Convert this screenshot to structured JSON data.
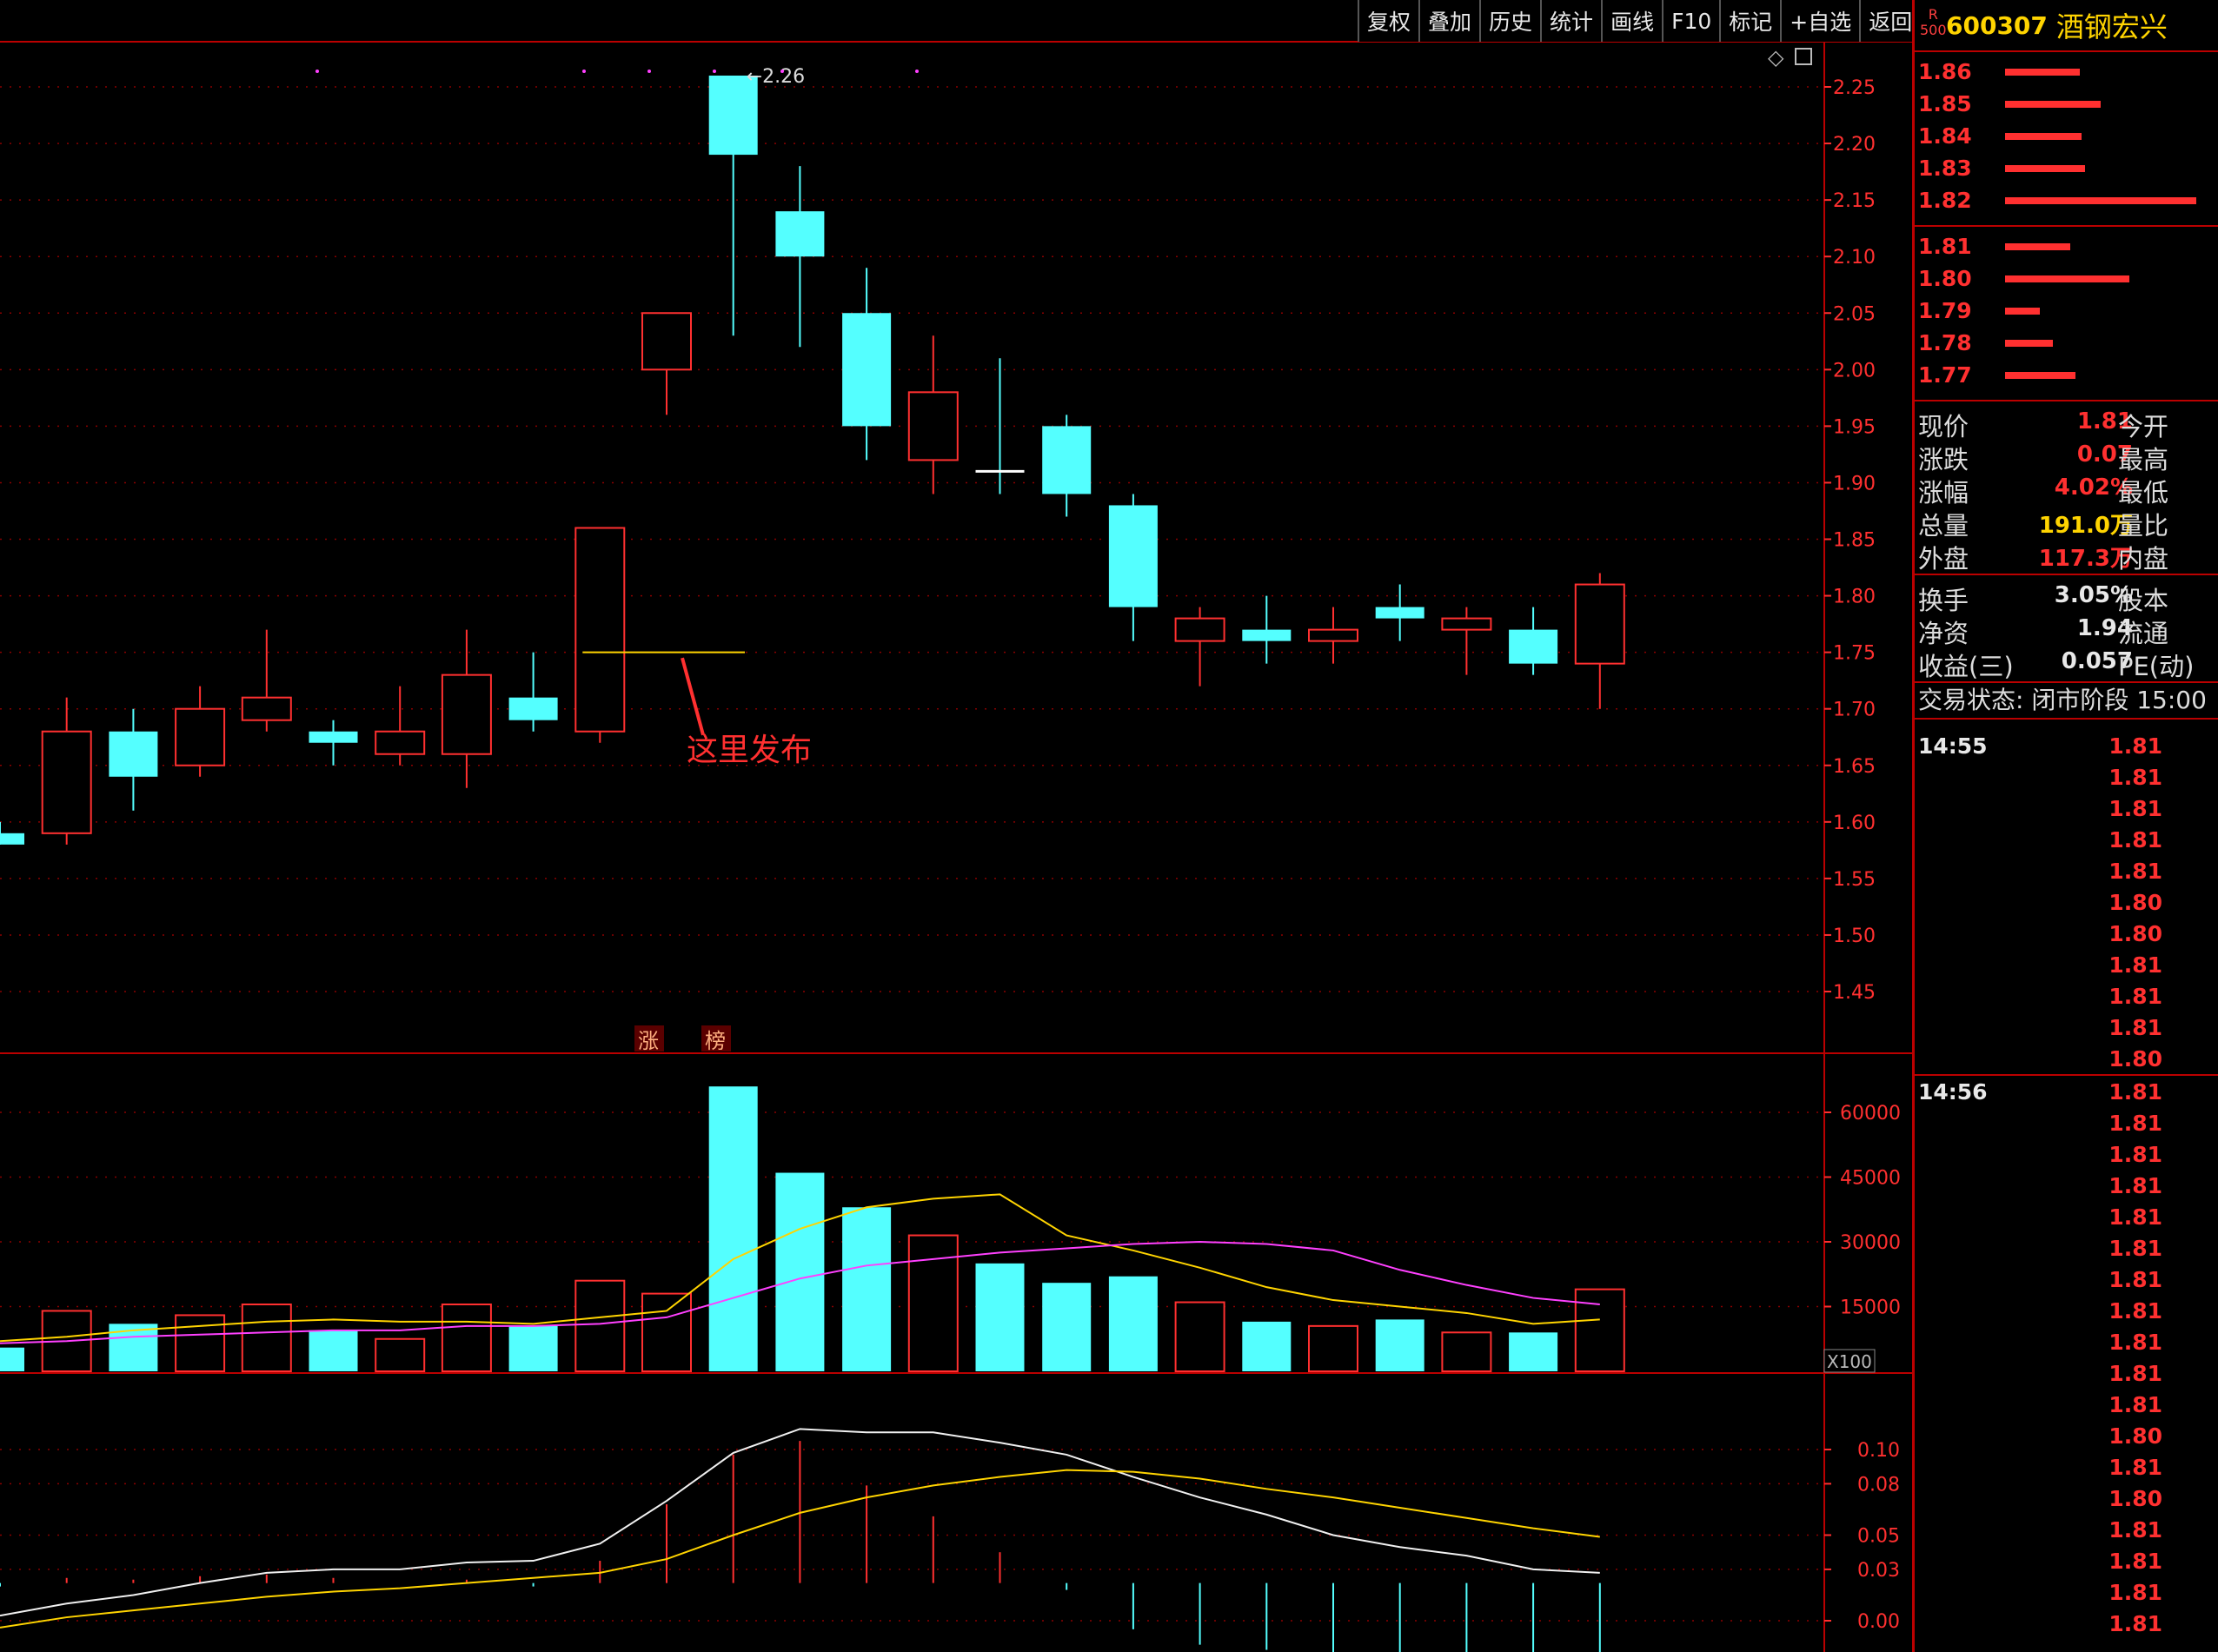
{
  "toolbar": {
    "buttons": [
      "复权",
      "叠加",
      "历史",
      "统计",
      "画线",
      "F10",
      "标记",
      "+自选",
      "返回"
    ]
  },
  "stock": {
    "code": "600307",
    "name": "酒钢宏兴",
    "badge_top": "R",
    "badge_bottom": "500"
  },
  "order_book": {
    "asks": [
      {
        "price": "1.86",
        "size": 0.39
      },
      {
        "price": "1.85",
        "size": 0.5
      },
      {
        "price": "1.84",
        "size": 0.4
      },
      {
        "price": "1.83",
        "size": 0.42
      },
      {
        "price": "1.82",
        "size": 1.0
      }
    ],
    "bids": [
      {
        "price": "1.81",
        "size": 0.34
      },
      {
        "price": "1.80",
        "size": 0.65
      },
      {
        "price": "1.79",
        "size": 0.18
      },
      {
        "price": "1.78",
        "size": 0.25
      },
      {
        "price": "1.77",
        "size": 0.37
      }
    ]
  },
  "stats": {
    "group1": [
      {
        "label": "现价",
        "value": "1.81",
        "color": "#ff3030",
        "label2": "今开"
      },
      {
        "label": "涨跌",
        "value": "0.07",
        "color": "#ff3030",
        "label2": "最高"
      },
      {
        "label": "涨幅",
        "value": "4.02%",
        "color": "#ff3030",
        "label2": "最低"
      },
      {
        "label": "总量",
        "value": "191.0万",
        "color": "#ffd400",
        "label2": "量比"
      },
      {
        "label": "外盘",
        "value": "117.3万",
        "color": "#ff3030",
        "label2": "内盘"
      }
    ],
    "group2": [
      {
        "label": "换手",
        "value": "3.05%",
        "color": "#e8e8e8",
        "label2": "股本"
      },
      {
        "label": "净资",
        "value": "1.94",
        "color": "#e8e8e8",
        "label2": "流通"
      },
      {
        "label": "收益(三)",
        "value": "0.057",
        "color": "#e8e8e8",
        "label2": "PE(动)"
      }
    ]
  },
  "trade_state": "交易状态: 闭市阶段 15:00",
  "ticks": [
    {
      "time": "14:55",
      "price": "1.81"
    },
    {
      "time": "",
      "price": "1.81"
    },
    {
      "time": "",
      "price": "1.81"
    },
    {
      "time": "",
      "price": "1.81"
    },
    {
      "time": "",
      "price": "1.81"
    },
    {
      "time": "",
      "price": "1.80"
    },
    {
      "time": "",
      "price": "1.80"
    },
    {
      "time": "",
      "price": "1.81"
    },
    {
      "time": "",
      "price": "1.81"
    },
    {
      "time": "",
      "price": "1.81"
    },
    {
      "time": "",
      "price": "1.80"
    },
    {
      "time": "14:56",
      "price": "1.81"
    },
    {
      "time": "",
      "price": "1.81"
    },
    {
      "time": "",
      "price": "1.81"
    },
    {
      "time": "",
      "price": "1.81"
    },
    {
      "time": "",
      "price": "1.81"
    },
    {
      "time": "",
      "price": "1.81"
    },
    {
      "time": "",
      "price": "1.81"
    },
    {
      "time": "",
      "price": "1.81"
    },
    {
      "time": "",
      "price": "1.81"
    },
    {
      "time": "",
      "price": "1.81"
    },
    {
      "time": "",
      "price": "1.81"
    },
    {
      "time": "",
      "price": "1.80"
    },
    {
      "time": "",
      "price": "1.81"
    },
    {
      "time": "",
      "price": "1.80"
    },
    {
      "time": "",
      "price": "1.81"
    },
    {
      "time": "",
      "price": "1.81"
    },
    {
      "time": "",
      "price": "1.81"
    },
    {
      "time": "",
      "price": "1.81"
    }
  ],
  "chart_data": [
    {
      "type": "candlestick",
      "ylim": [
        1.42,
        2.28
      ],
      "yticks": [
        "2.25",
        "2.20",
        "2.15",
        "2.10",
        "2.05",
        "2.00",
        "1.95",
        "1.90",
        "1.85",
        "1.80",
        "1.75",
        "1.70",
        "1.65",
        "1.60",
        "1.55",
        "1.50",
        "1.45"
      ],
      "max_label": "2.26",
      "annotation": "这里发布",
      "tag_labels": [
        "涨",
        "榜"
      ],
      "ohlc": [
        {
          "o": 1.59,
          "h": 1.6,
          "l": 1.58,
          "c": 1.58
        },
        {
          "o": 1.59,
          "h": 1.71,
          "l": 1.58,
          "c": 1.68
        },
        {
          "o": 1.68,
          "h": 1.7,
          "l": 1.61,
          "c": 1.64
        },
        {
          "o": 1.65,
          "h": 1.72,
          "l": 1.64,
          "c": 1.7
        },
        {
          "o": 1.69,
          "h": 1.77,
          "l": 1.68,
          "c": 1.71
        },
        {
          "o": 1.68,
          "h": 1.69,
          "l": 1.65,
          "c": 1.67
        },
        {
          "o": 1.66,
          "h": 1.72,
          "l": 1.65,
          "c": 1.68
        },
        {
          "o": 1.66,
          "h": 1.77,
          "l": 1.63,
          "c": 1.73
        },
        {
          "o": 1.71,
          "h": 1.75,
          "l": 1.68,
          "c": 1.69
        },
        {
          "o": 1.68,
          "h": 1.86,
          "l": 1.67,
          "c": 1.86
        },
        {
          "o": 2.0,
          "h": 2.05,
          "l": 1.96,
          "c": 2.05
        },
        {
          "o": 2.26,
          "h": 2.26,
          "l": 2.03,
          "c": 2.19
        },
        {
          "o": 2.14,
          "h": 2.18,
          "l": 2.02,
          "c": 2.1
        },
        {
          "o": 2.05,
          "h": 2.09,
          "l": 1.92,
          "c": 1.95
        },
        {
          "o": 1.92,
          "h": 2.03,
          "l": 1.89,
          "c": 1.98
        },
        {
          "o": 1.91,
          "h": 2.01,
          "l": 1.89,
          "c": 1.91
        },
        {
          "o": 1.95,
          "h": 1.96,
          "l": 1.87,
          "c": 1.89
        },
        {
          "o": 1.88,
          "h": 1.89,
          "l": 1.76,
          "c": 1.79
        },
        {
          "o": 1.76,
          "h": 1.79,
          "l": 1.72,
          "c": 1.78
        },
        {
          "o": 1.77,
          "h": 1.8,
          "l": 1.74,
          "c": 1.76
        },
        {
          "o": 1.76,
          "h": 1.79,
          "l": 1.74,
          "c": 1.77
        },
        {
          "o": 1.79,
          "h": 1.81,
          "l": 1.76,
          "c": 1.78
        },
        {
          "o": 1.77,
          "h": 1.79,
          "l": 1.73,
          "c": 1.78
        },
        {
          "o": 1.77,
          "h": 1.79,
          "l": 1.73,
          "c": 1.74
        },
        {
          "o": 1.74,
          "h": 1.82,
          "l": 1.7,
          "c": 1.81
        }
      ]
    },
    {
      "type": "bar",
      "ylim": [
        0,
        66000
      ],
      "yticks": [
        "60000",
        "45000",
        "30000",
        "15000"
      ],
      "unit_label": "X100",
      "values": [
        5500,
        14000,
        11000,
        13000,
        15500,
        9500,
        7500,
        15500,
        10500,
        21000,
        18000,
        66000,
        46000,
        38000,
        31500,
        25000,
        20500,
        22000,
        16000,
        11500,
        10500,
        12000,
        9000,
        9000,
        19000
      ],
      "ma5": [
        7000,
        8000,
        9500,
        10500,
        11500,
        12000,
        11500,
        11500,
        11000,
        12500,
        14000,
        26000,
        33000,
        38000,
        40000,
        41000,
        31500,
        28000,
        24000,
        19500,
        16500,
        15000,
        13500,
        11000,
        12000
      ],
      "ma10": [
        6500,
        7000,
        8000,
        8500,
        9000,
        9500,
        9500,
        10500,
        10500,
        11000,
        12500,
        17000,
        21500,
        24500,
        26000,
        27500,
        28500,
        29500,
        30000,
        29500,
        28000,
        23500,
        20000,
        17000,
        15500
      ]
    },
    {
      "type": "line",
      "ylim": [
        -0.005,
        0.12
      ],
      "yticks": [
        "0.10",
        "0.08",
        "0.05",
        "0.03",
        "0.00"
      ],
      "white_line": [
        0.003,
        0.01,
        0.015,
        0.022,
        0.028,
        0.03,
        0.03,
        0.034,
        0.035,
        0.045,
        0.07,
        0.098,
        0.112,
        0.11,
        0.11,
        0.104,
        0.097,
        0.084,
        0.072,
        0.062,
        0.05,
        0.043,
        0.038,
        0.03,
        0.028
      ],
      "yellow_line": [
        -0.004,
        0.002,
        0.006,
        0.01,
        0.014,
        0.017,
        0.019,
        0.022,
        0.025,
        0.028,
        0.036,
        0.05,
        0.063,
        0.072,
        0.079,
        0.084,
        0.088,
        0.087,
        0.083,
        0.077,
        0.072,
        0.066,
        0.06,
        0.054,
        0.049
      ],
      "macd": [
        0.02,
        0.025,
        0.024,
        0.026,
        0.027,
        0.025,
        0.022,
        0.024,
        0.02,
        0.035,
        0.068,
        0.097,
        0.105,
        0.079,
        0.061,
        0.04,
        0.018,
        -0.005,
        -0.014,
        -0.017,
        -0.02,
        -0.027,
        -0.025,
        -0.026,
        -0.021
      ]
    }
  ]
}
